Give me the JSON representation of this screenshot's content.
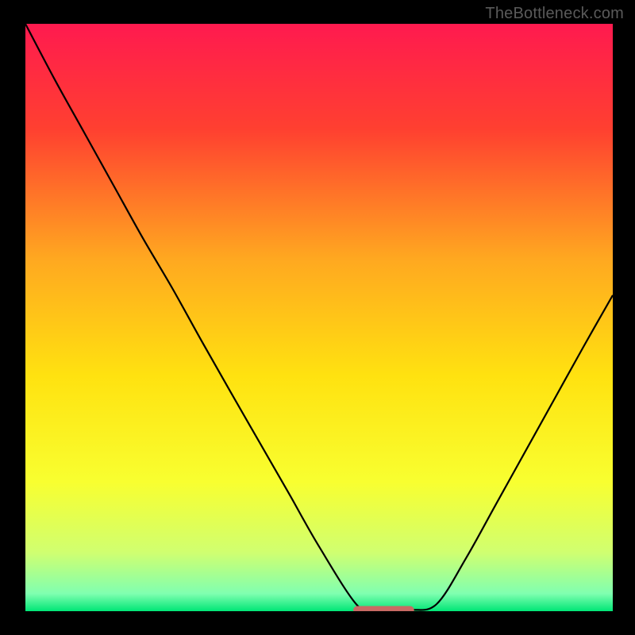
{
  "attribution": "TheBottleneck.com",
  "chart_data": {
    "type": "line",
    "title": "",
    "xlabel": "",
    "ylabel": "",
    "xlim": [
      0,
      1
    ],
    "ylim": [
      0,
      1
    ],
    "background_gradient": {
      "stops": [
        {
          "offset": 0.0,
          "color": "#ff1a4f"
        },
        {
          "offset": 0.18,
          "color": "#ff4030"
        },
        {
          "offset": 0.4,
          "color": "#ffa820"
        },
        {
          "offset": 0.6,
          "color": "#ffe210"
        },
        {
          "offset": 0.78,
          "color": "#f8ff30"
        },
        {
          "offset": 0.9,
          "color": "#d0ff70"
        },
        {
          "offset": 0.97,
          "color": "#80ffb0"
        },
        {
          "offset": 1.0,
          "color": "#00e676"
        }
      ]
    },
    "curve": {
      "description": "V-shaped bottleneck curve with flat basin near optimum",
      "x": [
        0.0,
        0.05,
        0.1,
        0.15,
        0.2,
        0.25,
        0.3,
        0.35,
        0.4,
        0.45,
        0.5,
        0.565,
        0.6,
        0.655,
        0.7,
        0.75,
        0.8,
        0.85,
        0.9,
        0.95,
        1.0
      ],
      "y": [
        1.0,
        0.905,
        0.815,
        0.725,
        0.635,
        0.55,
        0.46,
        0.372,
        0.285,
        0.198,
        0.11,
        0.01,
        0.002,
        0.002,
        0.012,
        0.09,
        0.18,
        0.27,
        0.36,
        0.45,
        0.538
      ]
    },
    "basin_segment": {
      "x0": 0.565,
      "x1": 0.655,
      "y": 0.002,
      "color": "#c86a64",
      "stroke_width_px": 10
    }
  }
}
